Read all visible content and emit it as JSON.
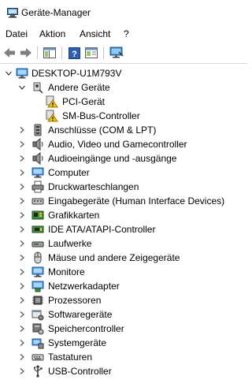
{
  "window": {
    "title": "Geräte-Manager"
  },
  "menu": [
    "Datei",
    "Aktion",
    "Ansicht",
    "?"
  ],
  "toolbar": [
    "back-icon",
    "forward-icon",
    "show-hide-tree-icon",
    "help-icon",
    "properties-icon",
    "monitor-scan-icon"
  ],
  "tree": {
    "root": {
      "label": "DESKTOP-U1M793V",
      "expanded": true
    },
    "categories": [
      {
        "label": "Andere Geräte",
        "icon": "unknown-device-icon",
        "expanded": true,
        "children": [
          {
            "label": "PCI-Gerät",
            "icon": "warning-device-icon"
          },
          {
            "label": "SM-Bus-Controller",
            "icon": "warning-device-icon"
          }
        ]
      },
      {
        "label": "Anschlüsse (COM & LPT)",
        "icon": "port-icon",
        "expanded": false
      },
      {
        "label": "Audio, Video und Gamecontroller",
        "icon": "speaker-icon",
        "expanded": false
      },
      {
        "label": "Audioeingänge und -ausgänge",
        "icon": "speaker-icon",
        "expanded": false
      },
      {
        "label": "Computer",
        "icon": "computer-icon",
        "expanded": false
      },
      {
        "label": "Druckwarteschlangen",
        "icon": "printer-icon",
        "expanded": false
      },
      {
        "label": "Eingabegeräte (Human Interface Devices)",
        "icon": "hid-icon",
        "expanded": false
      },
      {
        "label": "Grafikkarten",
        "icon": "display-adapter-icon",
        "expanded": false
      },
      {
        "label": "IDE ATA/ATAPI-Controller",
        "icon": "ide-controller-icon",
        "expanded": false
      },
      {
        "label": "Laufwerke",
        "icon": "disk-drive-icon",
        "expanded": false
      },
      {
        "label": "Mäuse und andere Zeigegeräte",
        "icon": "mouse-icon",
        "expanded": false
      },
      {
        "label": "Monitore",
        "icon": "monitor-icon",
        "expanded": false
      },
      {
        "label": "Netzwerkadapter",
        "icon": "network-adapter-icon",
        "expanded": false
      },
      {
        "label": "Prozessoren",
        "icon": "processor-icon",
        "expanded": false
      },
      {
        "label": "Softwaregeräte",
        "icon": "software-device-icon",
        "expanded": false
      },
      {
        "label": "Speichercontroller",
        "icon": "storage-controller-icon",
        "expanded": false
      },
      {
        "label": "Systemgeräte",
        "icon": "system-device-icon",
        "expanded": false
      },
      {
        "label": "Tastaturen",
        "icon": "keyboard-icon",
        "expanded": false
      },
      {
        "label": "USB-Controller",
        "icon": "usb-icon",
        "expanded": false
      }
    ]
  }
}
